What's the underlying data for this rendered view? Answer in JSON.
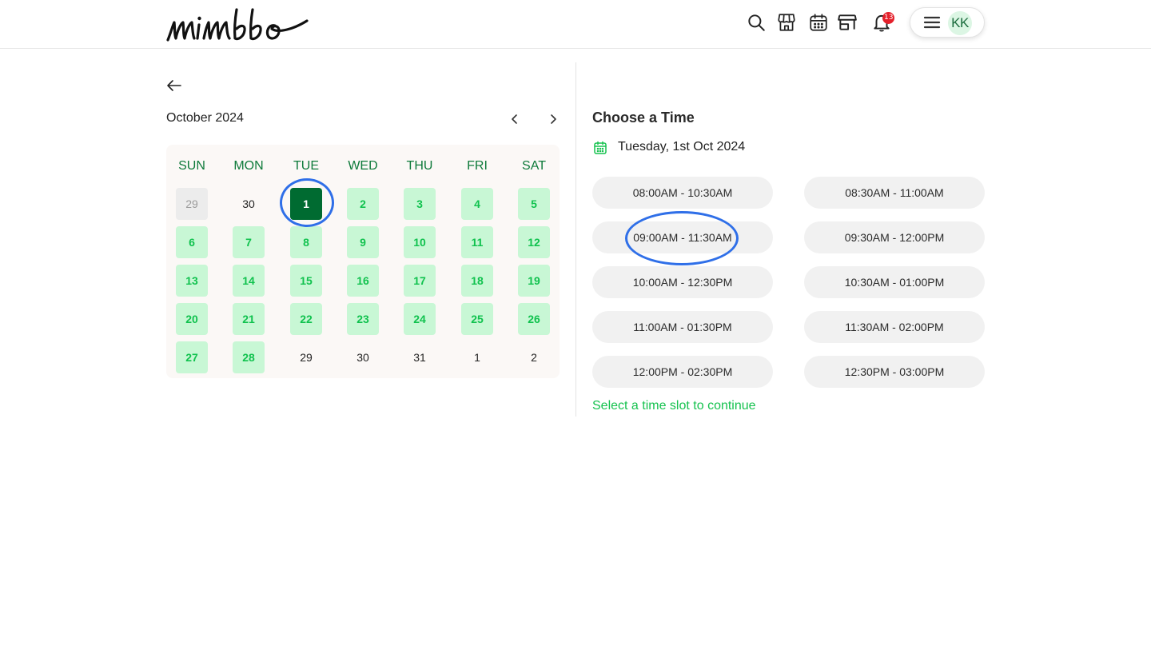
{
  "header": {
    "logo_text": "mimbbo",
    "icons": [
      "search-icon",
      "storefront-icon",
      "calendar-icon",
      "shop-icon",
      "bell-icon"
    ],
    "notification_count": "13",
    "avatar_initials": "KK"
  },
  "calendar": {
    "month_label": "October 2024",
    "weekdays": [
      "SUN",
      "MON",
      "TUE",
      "WED",
      "THU",
      "FRI",
      "SAT"
    ],
    "weeks": [
      [
        {
          "d": "29",
          "s": "past"
        },
        {
          "d": "30",
          "s": "plain"
        },
        {
          "d": "1",
          "s": "selected"
        },
        {
          "d": "2",
          "s": "avail"
        },
        {
          "d": "3",
          "s": "avail"
        },
        {
          "d": "4",
          "s": "avail"
        },
        {
          "d": "5",
          "s": "avail"
        }
      ],
      [
        {
          "d": "6",
          "s": "avail"
        },
        {
          "d": "7",
          "s": "avail"
        },
        {
          "d": "8",
          "s": "avail"
        },
        {
          "d": "9",
          "s": "avail"
        },
        {
          "d": "10",
          "s": "avail"
        },
        {
          "d": "11",
          "s": "avail"
        },
        {
          "d": "12",
          "s": "avail"
        }
      ],
      [
        {
          "d": "13",
          "s": "avail"
        },
        {
          "d": "14",
          "s": "avail"
        },
        {
          "d": "15",
          "s": "avail"
        },
        {
          "d": "16",
          "s": "avail"
        },
        {
          "d": "17",
          "s": "avail"
        },
        {
          "d": "18",
          "s": "avail"
        },
        {
          "d": "19",
          "s": "avail"
        }
      ],
      [
        {
          "d": "20",
          "s": "avail"
        },
        {
          "d": "21",
          "s": "avail"
        },
        {
          "d": "22",
          "s": "avail"
        },
        {
          "d": "23",
          "s": "avail"
        },
        {
          "d": "24",
          "s": "avail"
        },
        {
          "d": "25",
          "s": "avail"
        },
        {
          "d": "26",
          "s": "avail"
        }
      ],
      [
        {
          "d": "27",
          "s": "avail"
        },
        {
          "d": "28",
          "s": "avail"
        },
        {
          "d": "29",
          "s": "plain"
        },
        {
          "d": "30",
          "s": "plain"
        },
        {
          "d": "31",
          "s": "plain"
        },
        {
          "d": "1",
          "s": "plain"
        },
        {
          "d": "2",
          "s": "plain"
        }
      ]
    ]
  },
  "time_panel": {
    "title": "Choose a Time",
    "selected_date": "Tuesday, 1st Oct 2024",
    "slots": [
      "08:00AM - 10:30AM",
      "08:30AM - 11:00AM",
      "09:00AM - 11:30AM",
      "09:30AM - 12:00PM",
      "10:00AM - 12:30PM",
      "10:30AM - 01:00PM",
      "11:00AM - 01:30PM",
      "11:30AM - 02:00PM",
      "12:00PM - 02:30PM",
      "12:30PM - 03:00PM"
    ],
    "hint": "Select a time slot to continue"
  },
  "colors": {
    "brand_green": "#006b31",
    "available_bg": "#c8f7d5",
    "available_text": "#10c24e",
    "hint_green": "#16c24f",
    "annotation_blue": "#2f6fe8"
  }
}
